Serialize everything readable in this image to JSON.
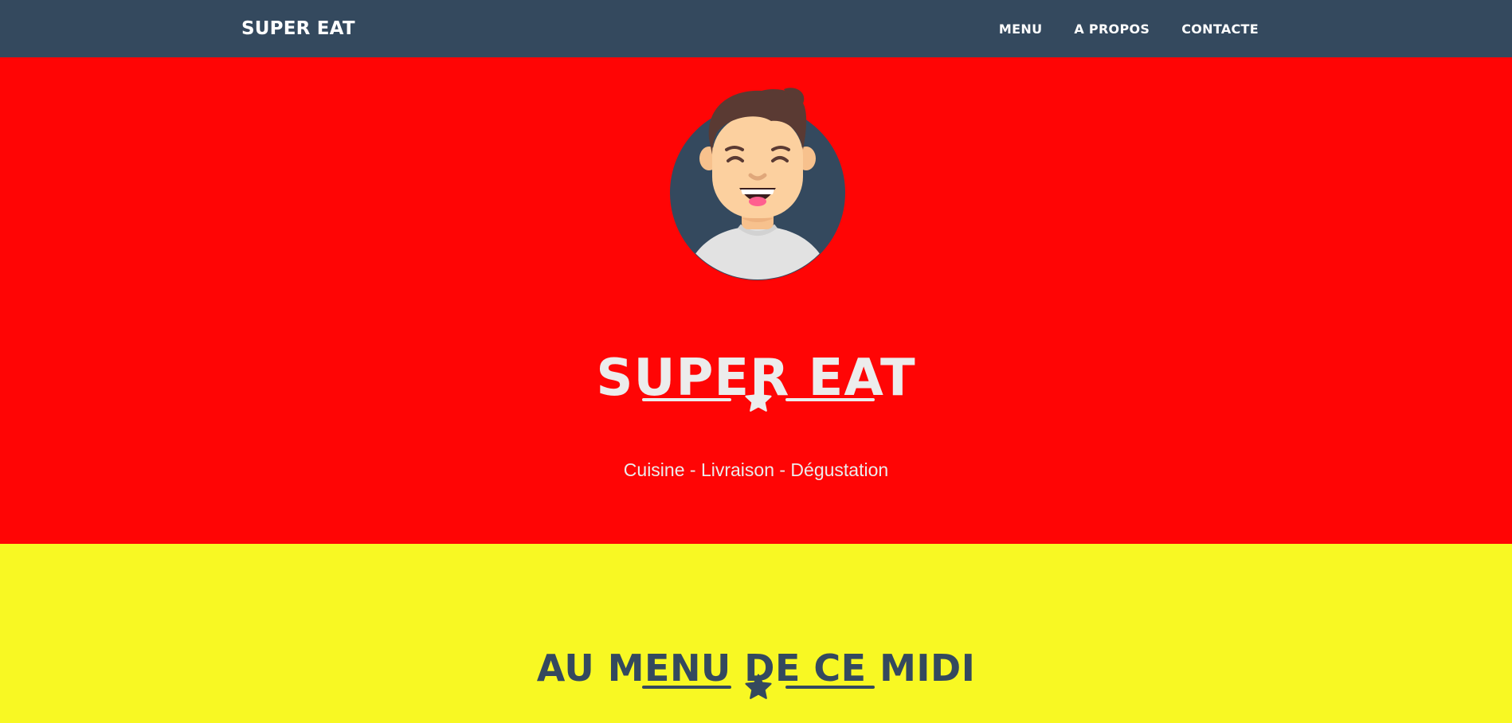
{
  "navbar": {
    "brand": "SUPER EAT",
    "links": [
      {
        "label": "MENU"
      },
      {
        "label": "A PROPOS"
      },
      {
        "label": "CONTACTE"
      }
    ],
    "background": "#34495e"
  },
  "hero": {
    "avatar_icon": "smiling-man-avatar",
    "title": "SUPER EAT",
    "divider_icon": "star-icon",
    "subtitle": "Cuisine - Livraison - Dégustation",
    "background": "#ff0505"
  },
  "menu_section": {
    "title": "AU MENU DE CE MIDI",
    "divider_icon": "star-icon",
    "background": "#f8f823"
  }
}
